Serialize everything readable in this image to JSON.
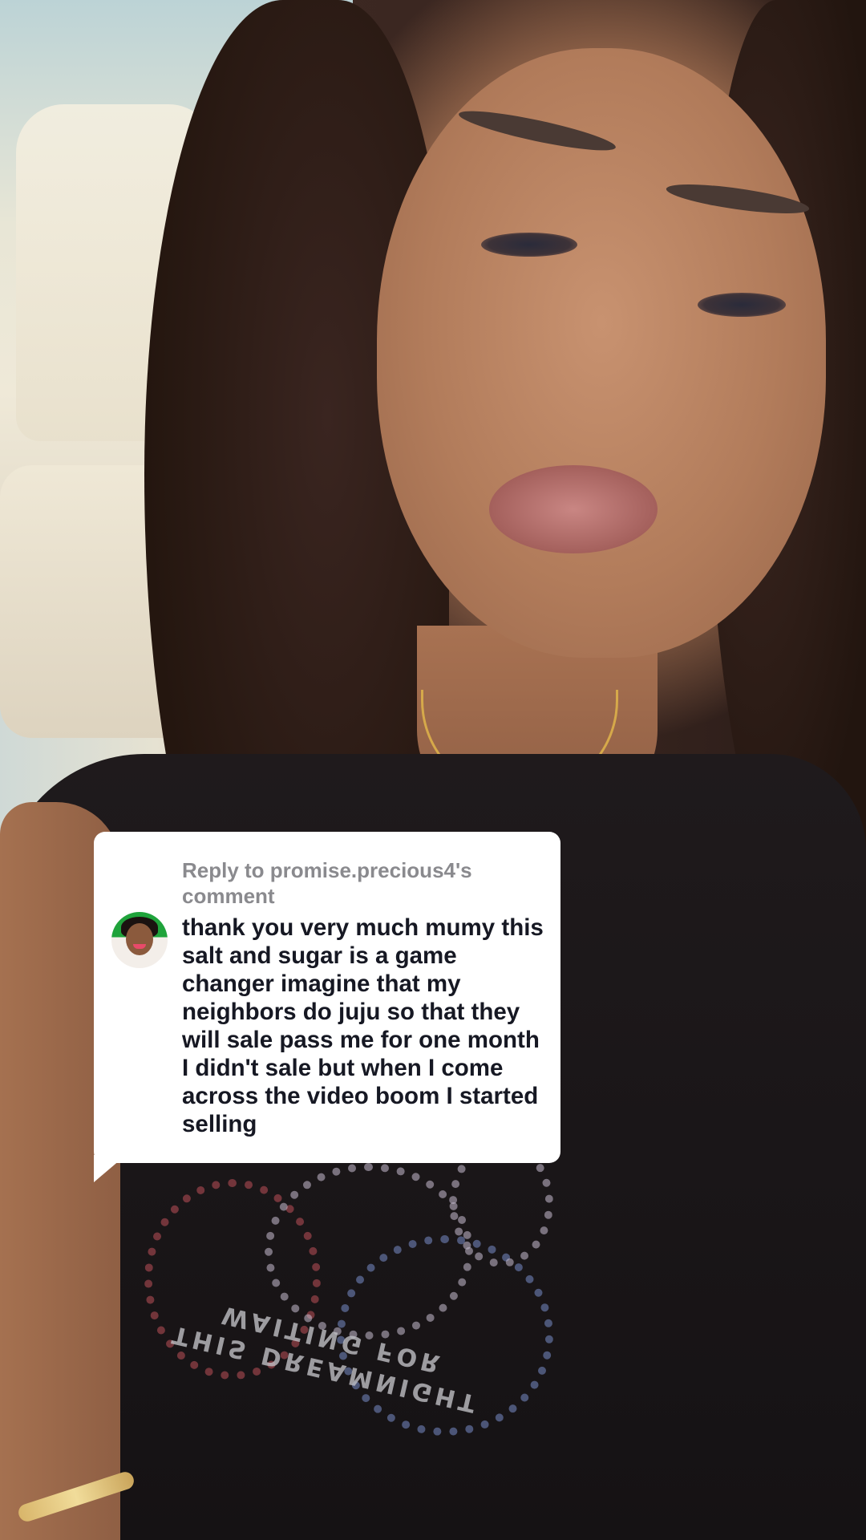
{
  "reply": {
    "header": "Reply to promise.precious4's comment",
    "body": "thank you very much mumy this salt and sugar is a game changer imagine that my neighbors do juju so that they will sale pass me for one month I didn't sale but when I come across the video boom I started selling",
    "avatar_icon": "user-avatar"
  },
  "shirt_print": {
    "text": "THIS DREAMNIGHT\nWAITING FOR"
  }
}
